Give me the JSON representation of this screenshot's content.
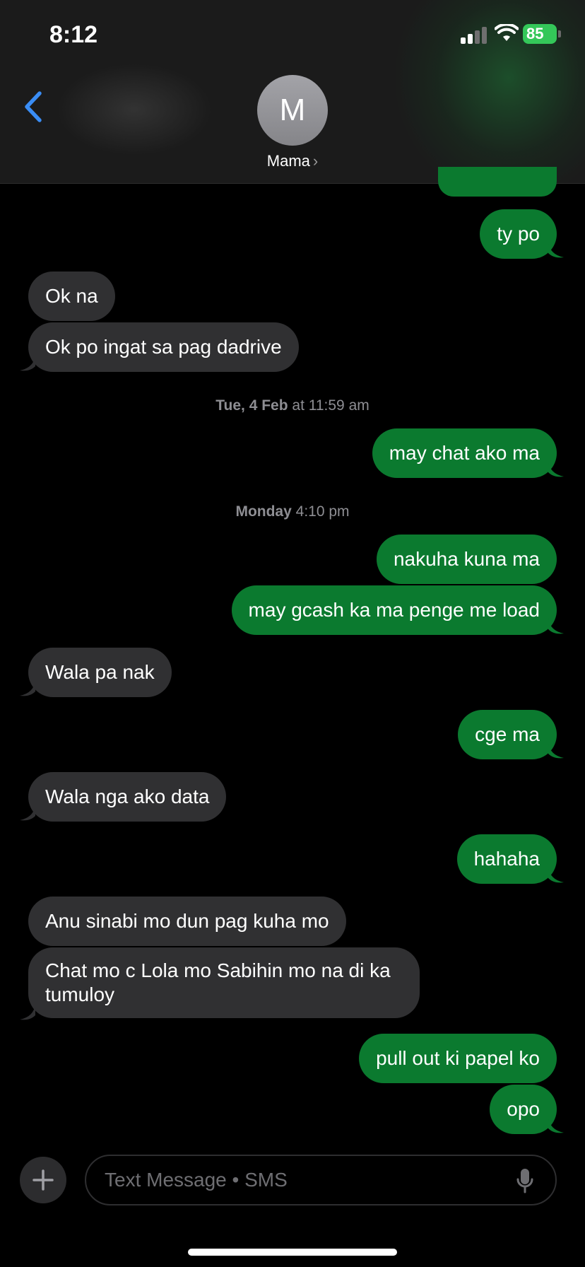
{
  "status_bar": {
    "time": "8:12",
    "battery": "85"
  },
  "header": {
    "avatar_initial": "M",
    "contact_name": "Mama",
    "contact_chevron": "›"
  },
  "colors": {
    "outgoing": "#0b7a2f",
    "incoming": "#303032",
    "accent": "#3a8df5",
    "background": "#000000"
  },
  "messages": [
    {
      "dir": "out",
      "text": "ty po"
    },
    {
      "dir": "in",
      "text": "Ok na"
    },
    {
      "dir": "in",
      "text": "Ok po ingat sa pag dadrive"
    },
    {
      "dir": "out",
      "text": "may chat ako ma"
    },
    {
      "dir": "out",
      "text": "nakuha kuna ma"
    },
    {
      "dir": "out",
      "text": "may gcash ka ma penge me load"
    },
    {
      "dir": "in",
      "text": "Wala pa nak"
    },
    {
      "dir": "out",
      "text": "cge ma"
    },
    {
      "dir": "in",
      "text": "Wala nga ako data"
    },
    {
      "dir": "out",
      "text": "hahaha"
    },
    {
      "dir": "in",
      "text": "Anu sinabi mo dun pag kuha mo"
    },
    {
      "dir": "in",
      "text": "Chat mo c Lola mo Sabihin mo na di ka tumuloy"
    },
    {
      "dir": "out",
      "text": "pull out ki papel ko"
    },
    {
      "dir": "out",
      "text": "opo"
    }
  ],
  "timestamps": [
    {
      "day": "Tue, 4 Feb",
      "time": "at 11:59 am"
    },
    {
      "day": "Monday",
      "time": "4:10 pm"
    }
  ],
  "composer": {
    "placeholder": "Text Message • SMS"
  },
  "icons": [
    "back-chevron-icon",
    "signal-icon",
    "wifi-icon",
    "battery-icon",
    "plus-icon",
    "microphone-icon"
  ]
}
